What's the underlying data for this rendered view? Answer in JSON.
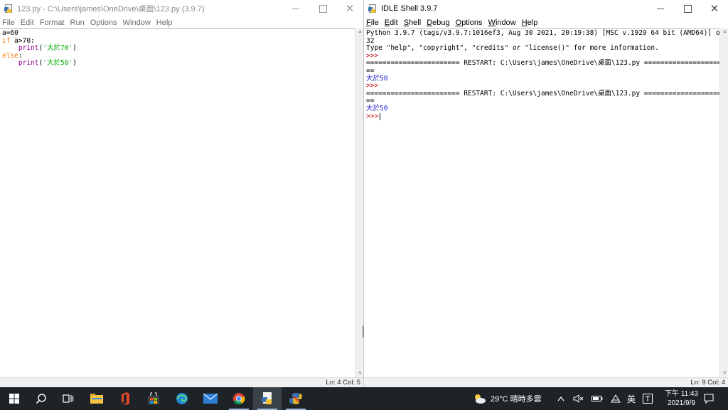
{
  "editor": {
    "title": "123.py - C:\\Users\\james\\OneDrive\\桌面\\123.py (3.9.7)",
    "menu": [
      "File",
      "Edit",
      "Format",
      "Run",
      "Options",
      "Window",
      "Help"
    ],
    "code": {
      "l1": "a=60",
      "l2_kw": "if",
      "l2_rest": " a>70:",
      "l3_indent": "    ",
      "l3_fn": "print",
      "l3_open": "(",
      "l3_str": "'大於70'",
      "l3_close": ")",
      "l4_kw": "else",
      "l4_rest": ":",
      "l5_indent": "    ",
      "l5_fn": "print",
      "l5_open": "(",
      "l5_str": "'大於50'",
      "l5_close": ")"
    },
    "status": "Ln: 4   Col: 5"
  },
  "shell": {
    "title": "IDLE Shell 3.9.7",
    "menu": [
      "File",
      "Edit",
      "Shell",
      "Debug",
      "Options",
      "Window",
      "Help"
    ],
    "lines": {
      "banner1": "Python 3.9.7 (tags/v3.9.7:1016ef3, Aug 30 2021, 20:19:38) [MSC v.1929 64 bit (AMD64)] on win",
      "banner2": "32",
      "banner3": "Type \"help\", \"copyright\", \"credits\" or \"license()\" for more information.",
      "prompt": ">>>",
      "restart": "======================= RESTART: C:\\Users\\james\\OneDrive\\桌面\\123.py ======================",
      "restart_wrap": "==",
      "output": "大於50"
    },
    "status": "Ln: 9   Col: 4"
  },
  "taskbar": {
    "weather": "29°C  晴時多雲",
    "ime": "英",
    "time": "下午 11:43",
    "date": "2021/9/9",
    "icons": [
      "windows-start-icon",
      "search-icon",
      "task-view-icon",
      "file-explorer-icon",
      "office-icon",
      "microsoft-store-icon",
      "edge-icon",
      "mail-icon",
      "chrome-icon",
      "idle-editor-icon",
      "python-idle-icon"
    ]
  },
  "colors": {
    "keyword": "#ff7700",
    "builtin": "#900090",
    "string": "#00aa00",
    "prompt": "#c00000",
    "output": "#2020d0",
    "taskbar": "#1e2328"
  }
}
